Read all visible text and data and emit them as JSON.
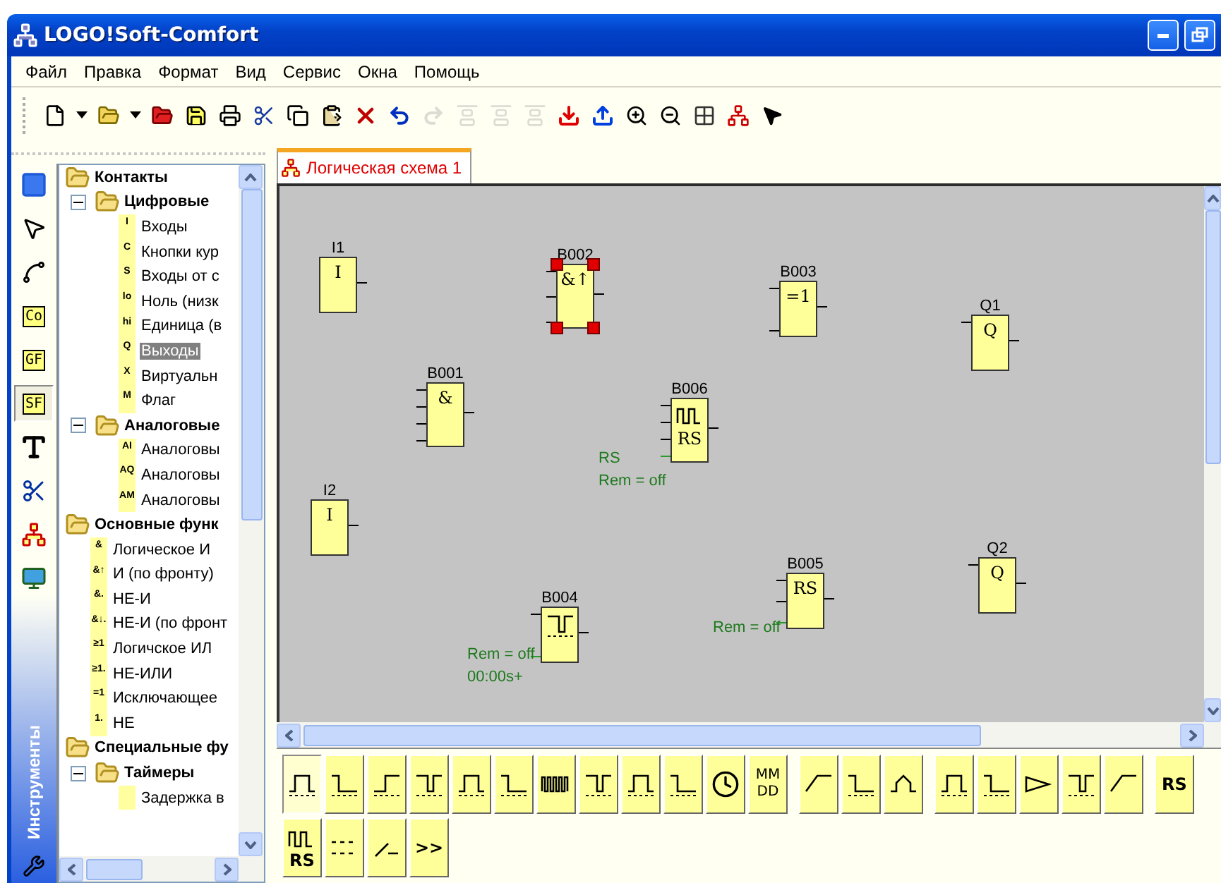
{
  "window": {
    "title": "LOGO!Soft-Comfort"
  },
  "menu": [
    "Файл",
    "Правка",
    "Формат",
    "Вид",
    "Сервис",
    "Окна",
    "Помощь"
  ],
  "toolbar": [
    {
      "kind": "new",
      "disabled": false
    },
    {
      "kind": "dropdown",
      "disabled": false
    },
    {
      "kind": "open",
      "disabled": false
    },
    {
      "kind": "dropdown",
      "disabled": false
    },
    {
      "kind": "open_red",
      "disabled": false
    },
    {
      "kind": "save",
      "disabled": false
    },
    {
      "kind": "print",
      "disabled": false
    },
    {
      "kind": "cut",
      "disabled": false
    },
    {
      "kind": "copy",
      "disabled": false
    },
    {
      "kind": "paste",
      "disabled": false
    },
    {
      "kind": "delete",
      "disabled": false
    },
    {
      "kind": "undo",
      "disabled": false
    },
    {
      "kind": "redo",
      "disabled": true
    },
    {
      "kind": "align",
      "disabled": true
    },
    {
      "kind": "align",
      "disabled": true
    },
    {
      "kind": "align",
      "disabled": true
    },
    {
      "kind": "download",
      "disabled": false
    },
    {
      "kind": "upload",
      "disabled": false
    },
    {
      "kind": "zoom_in",
      "disabled": false
    },
    {
      "kind": "zoom_out",
      "disabled": false
    },
    {
      "kind": "grid",
      "disabled": false
    },
    {
      "kind": "layout",
      "disabled": false
    },
    {
      "kind": "help",
      "disabled": false
    }
  ],
  "tools": [
    {
      "kind": "block",
      "selected": false
    },
    {
      "kind": "pointer",
      "selected": false
    },
    {
      "kind": "connector",
      "selected": false
    },
    {
      "kind": "tag",
      "label": "Co",
      "selected": false
    },
    {
      "kind": "tag",
      "label": "GF",
      "selected": false
    },
    {
      "kind": "tag",
      "label": "SF",
      "selected": true
    },
    {
      "kind": "text",
      "selected": false
    },
    {
      "kind": "scissors",
      "selected": false
    },
    {
      "kind": "diagram",
      "selected": false
    },
    {
      "kind": "computer",
      "selected": false
    }
  ],
  "tools_title": "Инструменты",
  "tree": [
    {
      "label": "Контакты",
      "children": [
        {
          "label": "Цифровые",
          "expanded": true,
          "children": [
            {
              "label": "Входы",
              "badge": "I",
              "selected": false
            },
            {
              "label": "Кнопки кур",
              "badge": "C",
              "selected": false
            },
            {
              "label": "Входы от с",
              "badge": "S",
              "selected": false
            },
            {
              "label": "Ноль (низк",
              "badge": "lo",
              "selected": false
            },
            {
              "label": "Единица (в",
              "badge": "hi",
              "selected": false
            },
            {
              "label": "Выходы",
              "badge": "Q",
              "selected": true
            },
            {
              "label": "Виртуальн",
              "badge": "X",
              "selected": false
            },
            {
              "label": "Флаг",
              "badge": "M",
              "selected": false
            }
          ]
        },
        {
          "label": "Аналоговые",
          "expanded": true,
          "children": [
            {
              "label": "Аналоговы",
              "badge": "AI",
              "selected": false
            },
            {
              "label": "Аналоговы",
              "badge": "AQ",
              "selected": false
            },
            {
              "label": "Аналоговы",
              "badge": "AM",
              "selected": false
            }
          ]
        }
      ]
    },
    {
      "label": "Основные функ",
      "children": [
        {
          "label": "Логическое И",
          "badge": "&",
          "selected": false
        },
        {
          "label": "И (по фронту)",
          "badge": "&↑",
          "selected": false
        },
        {
          "label": "НЕ-И",
          "badge": "&.",
          "selected": false
        },
        {
          "label": "НЕ-И (по фронт",
          "badge": "&↓.",
          "selected": false
        },
        {
          "label": "Логичское ИЛ",
          "badge": "≥1",
          "selected": false
        },
        {
          "label": "НЕ-ИЛИ",
          "badge": "≥1.",
          "selected": false
        },
        {
          "label": "Исключающее",
          "badge": "=1",
          "selected": false
        },
        {
          "label": "НЕ",
          "badge": "1.",
          "selected": false
        }
      ]
    },
    {
      "label": "Специальные фу",
      "children": [
        {
          "label": "Таймеры",
          "expanded": true,
          "children": [
            {
              "label": "Задержка в",
              "selected": false
            }
          ]
        }
      ]
    }
  ],
  "tab": {
    "label": "Логическая схема 1",
    "selected": true
  },
  "blocks": [
    {
      "name": "I1",
      "kind": "text",
      "symbol": "I",
      "selected": false
    },
    {
      "name": "B002",
      "kind": "text",
      "symbol": "&↑",
      "selected": true
    },
    {
      "name": "B003",
      "kind": "text",
      "symbol": "=1",
      "selected": false
    },
    {
      "name": "Q1",
      "kind": "text",
      "symbol": "Q",
      "selected": false
    },
    {
      "name": "B001",
      "kind": "text",
      "symbol": "&",
      "selected": false
    },
    {
      "name": "B006",
      "kind": "pulse_rs",
      "symbol": "RS",
      "selected": false,
      "notes": [
        "RS",
        "Rem = off"
      ]
    },
    {
      "name": "I2",
      "kind": "text",
      "symbol": "I",
      "selected": false
    },
    {
      "name": "B004",
      "kind": "pulse",
      "selected": false,
      "notes": [
        "Rem = off",
        "00:00s+"
      ]
    },
    {
      "name": "B005",
      "kind": "text",
      "symbol": "RS",
      "selected": false,
      "notes": [
        "Rem = off"
      ]
    },
    {
      "name": "Q2",
      "kind": "text",
      "symbol": "Q",
      "selected": false
    }
  ],
  "palette_rows": [
    [
      [
        {
          "kind": "pulse",
          "selected": true
        },
        {
          "kind": "pulse",
          "selected": false
        },
        {
          "kind": "pulse",
          "selected": false
        },
        {
          "kind": "pulse",
          "selected": false
        },
        {
          "kind": "pulse",
          "selected": false
        },
        {
          "kind": "pulse",
          "selected": false
        },
        {
          "kind": "train",
          "selected": false
        },
        {
          "kind": "pulse",
          "selected": false
        },
        {
          "kind": "pulse",
          "selected": false
        },
        {
          "kind": "pulse",
          "selected": false
        },
        {
          "kind": "clock",
          "selected": false
        },
        {
          "kind": "text",
          "label": "MM DD",
          "selected": false
        }
      ],
      [
        {
          "kind": "ramp",
          "selected": false
        },
        {
          "kind": "pulse",
          "selected": false
        },
        {
          "kind": "peak",
          "selected": false
        }
      ],
      [
        {
          "kind": "pulse",
          "selected": false
        },
        {
          "kind": "pulse",
          "selected": false
        },
        {
          "kind": "amp",
          "selected": false
        },
        {
          "kind": "pulse",
          "selected": false
        },
        {
          "kind": "ramp",
          "selected": false
        }
      ],
      [
        {
          "kind": "text",
          "label": "RS",
          "selected": false
        }
      ]
    ],
    [
      [
        {
          "kind": "pulse_rs",
          "label": "RS",
          "selected": false
        },
        {
          "kind": "dots",
          "selected": false
        },
        {
          "kind": "slash",
          "selected": false
        },
        {
          "kind": "text",
          "label": ">>",
          "selected": false
        }
      ]
    ]
  ]
}
